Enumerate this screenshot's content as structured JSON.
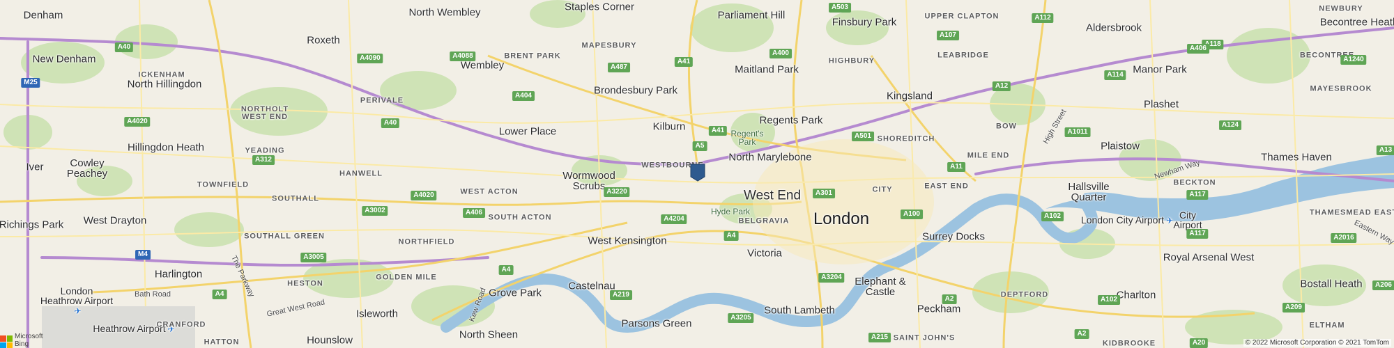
{
  "map": {
    "provider_brand": "Microsoft Bing",
    "brand_line1": "Microsoft",
    "brand_line2": "Bing",
    "copyright": "© 2022 Microsoft Corporation © 2021 TomTom",
    "city_label": "London",
    "pin_color": "#2e5a8f",
    "colors": {
      "land": "#f2efe6",
      "park": "#cfe3b6",
      "water": "#9cc3e0",
      "motorway": "#b58ad0",
      "major_road": "#f3d36b",
      "minor_road": "#fbeaa6"
    },
    "places": [
      {
        "name": "Denham",
        "size": "m"
      },
      {
        "name": "North Wembley",
        "size": "m"
      },
      {
        "name": "Staples Corner",
        "size": "m"
      },
      {
        "name": "Parliament Hill",
        "size": "m"
      },
      {
        "name": "Finsbury Park",
        "size": "m"
      },
      {
        "name": "Aldersbrook",
        "size": "m"
      },
      {
        "name": "Becontree Heath",
        "size": "m"
      },
      {
        "name": "Roxeth",
        "size": "m"
      },
      {
        "name": "New Denham",
        "size": "m"
      },
      {
        "name": "Wembley",
        "size": "m"
      },
      {
        "name": "Maitland Park",
        "size": "m"
      },
      {
        "name": "Manor Park",
        "size": "m"
      },
      {
        "name": "North Hillingdon",
        "size": "m"
      },
      {
        "name": "Brondesbury Park",
        "size": "m"
      },
      {
        "name": "Kingsland",
        "size": "m"
      },
      {
        "name": "Plashet",
        "size": "m"
      },
      {
        "name": "Regents Park",
        "size": "m"
      },
      {
        "name": "Kilburn",
        "size": "m"
      },
      {
        "name": "Lower Place",
        "size": "m"
      },
      {
        "name": "Hillingdon Heath",
        "size": "m"
      },
      {
        "name": "Plaistow",
        "size": "m"
      },
      {
        "name": "Iver",
        "size": "m"
      },
      {
        "name": "Cowley Peachey",
        "size": "m"
      },
      {
        "name": "North Marylebone",
        "size": "m"
      },
      {
        "name": "Thames Haven",
        "size": "m"
      },
      {
        "name": "Wormwood Scrubs",
        "size": "m"
      },
      {
        "name": "West End",
        "size": "l"
      },
      {
        "name": "Hallsville Quarter",
        "size": "m"
      },
      {
        "name": "Richings Park",
        "size": "m"
      },
      {
        "name": "West Drayton",
        "size": "m"
      },
      {
        "name": "London City Airport",
        "size": "s"
      },
      {
        "name": "City Airport",
        "size": "s"
      },
      {
        "name": "Surrey Docks",
        "size": "m"
      },
      {
        "name": "West Kensington",
        "size": "m"
      },
      {
        "name": "Victoria",
        "size": "m"
      },
      {
        "name": "Royal Arsenal West",
        "size": "m"
      },
      {
        "name": "Harlington",
        "size": "m"
      },
      {
        "name": "Elephant & Castle",
        "size": "m"
      },
      {
        "name": "London Heathrow Airport",
        "size": "s"
      },
      {
        "name": "Grove Park",
        "size": "m"
      },
      {
        "name": "Castelnau",
        "size": "m"
      },
      {
        "name": "Charlton",
        "size": "m"
      },
      {
        "name": "Bostall Heath",
        "size": "m"
      },
      {
        "name": "Isleworth",
        "size": "m"
      },
      {
        "name": "Parsons Green",
        "size": "m"
      },
      {
        "name": "South Lambeth",
        "size": "m"
      },
      {
        "name": "Peckham",
        "size": "m"
      },
      {
        "name": "Heathrow Airport",
        "size": "s"
      },
      {
        "name": "North Sheen",
        "size": "m"
      },
      {
        "name": "Hounslow",
        "size": "m"
      }
    ],
    "districts": [
      "ICKENHAM",
      "UPPER CLAPTON",
      "NEWBURY",
      "BRENT PARK",
      "MAPESBURY",
      "HIGHBURY",
      "LEABRIDGE",
      "BECONTREE",
      "MAYESBROOK",
      "NORTHOLT WEST END",
      "PERIVALE",
      "BOW",
      "SHOREDITCH",
      "YEADING",
      "HANWELL",
      "MILE END",
      "TOWNFIELD",
      "SOUTHALL",
      "WESTBOURNE",
      "CITY",
      "EAST END",
      "BECKTON",
      "WEST ACTON",
      "SOUTH ACTON",
      "BELGRAVIA",
      "THAMESMEAD EAST",
      "SOUTHALL GREEN",
      "NORTHFIELD",
      "GOLDEN MILE",
      "HESTON",
      "DEPTFORD",
      "CRANFORD",
      "ELTHAM",
      "HATTON",
      "SAINT JOHN'S",
      "KIDBROOKE"
    ],
    "parks": [
      "Regent's Park",
      "Hyde Park"
    ],
    "road_shields": [
      "A503",
      "A112",
      "A40",
      "A4088",
      "A107",
      "A118",
      "A406",
      "A4090",
      "A487",
      "A41",
      "A400",
      "A12",
      "A1240",
      "A114",
      "A404",
      "A4020",
      "A40",
      "A41",
      "A5",
      "A501",
      "A1011",
      "A124",
      "A312",
      "A13",
      "A11",
      "A3220",
      "A301",
      "A117",
      "A4020",
      "A3002",
      "A406",
      "A4204",
      "A100",
      "A102",
      "A117",
      "A2016",
      "A4",
      "A3005",
      "M25",
      "M4",
      "A4",
      "A219",
      "A3204",
      "A2",
      "A102",
      "A206",
      "A4",
      "A3205",
      "A209",
      "A215",
      "A2",
      "A20"
    ],
    "road_labels": [
      "Bath Road",
      "Great West Road",
      "The Parkway",
      "Kew Road",
      "High Street",
      "Newham Way",
      "Eastern Way"
    ]
  }
}
